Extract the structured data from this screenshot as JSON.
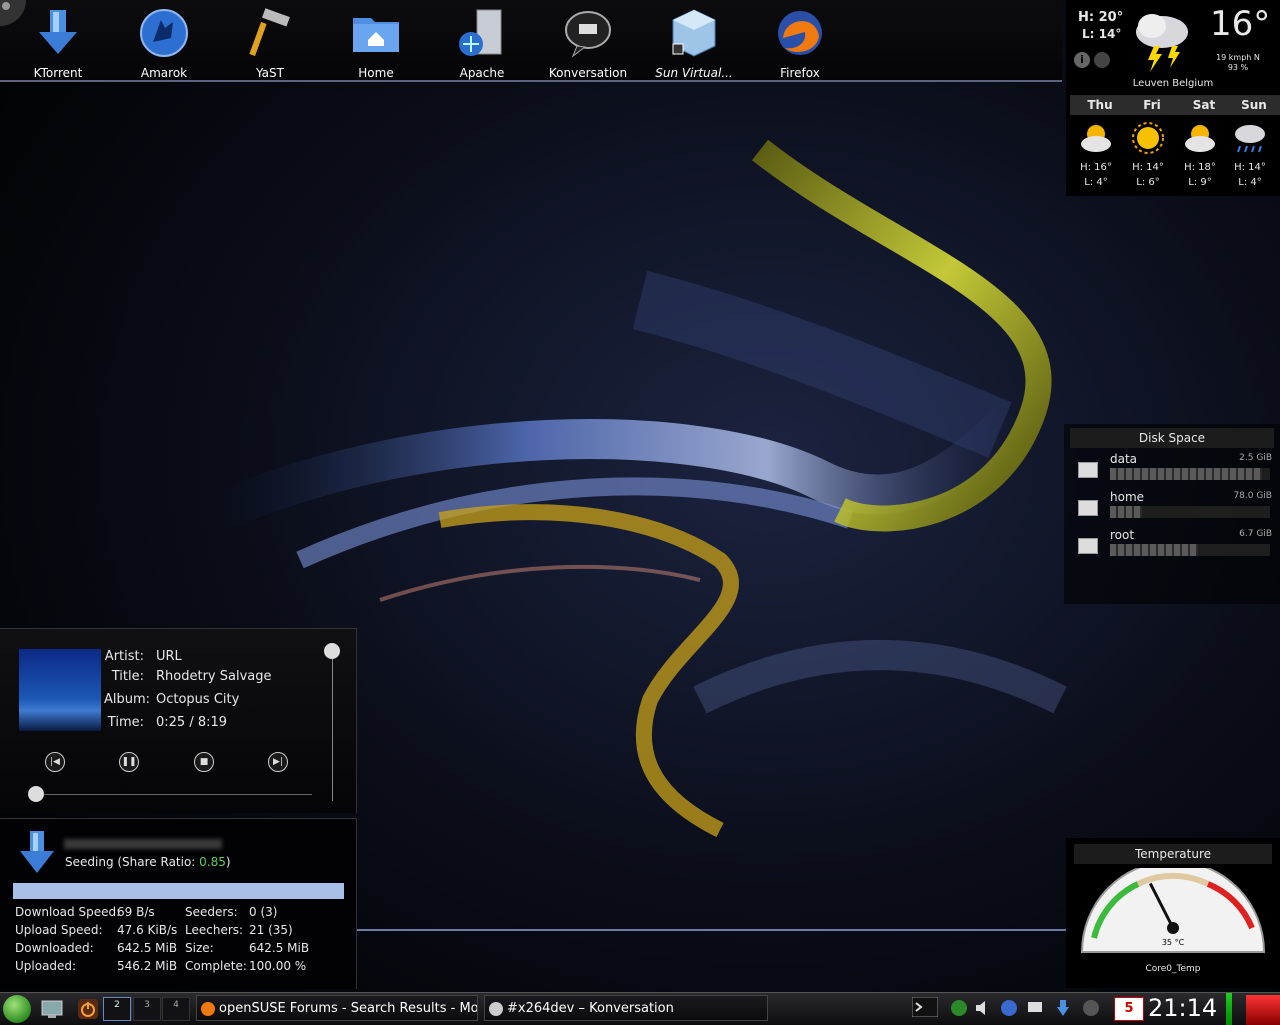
{
  "launcher": {
    "items": [
      {
        "label": "KTorrent",
        "icon": "ktorrent-icon"
      },
      {
        "label": "Amarok",
        "icon": "amarok-icon"
      },
      {
        "label": "YaST",
        "icon": "yast-hammer-icon"
      },
      {
        "label": "Home",
        "icon": "home-folder-icon"
      },
      {
        "label": "Apache",
        "icon": "apache-server-icon"
      },
      {
        "label": "Konversation",
        "icon": "konversation-icon"
      },
      {
        "label": "Sun Virtual...",
        "icon": "virtualbox-icon"
      },
      {
        "label": "Firefox",
        "icon": "firefox-icon"
      }
    ]
  },
  "weather": {
    "high": "H: 20°",
    "low": "L: 14°",
    "current_temp": "16°",
    "wind": "19 kmph N",
    "humidity": "93 %",
    "location": "Leuven Belgium",
    "condition_icon": "thunderstorm-icon",
    "forecast": [
      {
        "day": "Thu",
        "high": "H: 16°",
        "low": "L: 4°",
        "icon": "partly-cloudy-icon"
      },
      {
        "day": "Fri",
        "high": "H: 14°",
        "low": "L: 6°",
        "icon": "sunny-icon"
      },
      {
        "day": "Sat",
        "high": "H: 18°",
        "low": "L: 9°",
        "icon": "partly-cloudy-icon"
      },
      {
        "day": "Sun",
        "high": "H: 14°",
        "low": "L: 4°",
        "icon": "rain-icon"
      }
    ]
  },
  "disk": {
    "title": "Disk Space",
    "items": [
      {
        "name": "data",
        "size": "2.5 GiB",
        "used_fraction": 0.95
      },
      {
        "name": "home",
        "size": "78.0 GiB",
        "used_fraction": 0.2
      },
      {
        "name": "root",
        "size": "6.7 GiB",
        "used_fraction": 0.55
      }
    ]
  },
  "player": {
    "artist_label": "Artist:",
    "artist": "URL",
    "title_label": "Title:",
    "title": "Rhodetry Salvage",
    "album_label": "Album:",
    "album": "Octopus City",
    "time_label": "Time:",
    "time": "0:25 / 8:19"
  },
  "torrent": {
    "status_prefix": "Seeding (Share Ratio: ",
    "ratio": "0.85",
    "status_suffix": ")",
    "progress_percent": 100,
    "download_speed_label": "Download Speed:",
    "download_speed": "69 B/s",
    "upload_speed_label": "Upload Speed:",
    "upload_speed": "47.6 KiB/s",
    "downloaded_label": "Downloaded:",
    "downloaded": "642.5 MiB",
    "uploaded_label": "Uploaded:",
    "uploaded": "546.2 MiB",
    "seeders_label": "Seeders:",
    "seeders": "0 (3)",
    "leechers_label": "Leechers:",
    "leechers": "21 (35)",
    "size_label": "Size:",
    "size": "642.5 MiB",
    "complete_label": "Complete:",
    "complete": "100.00 %"
  },
  "temperature": {
    "title": "Temperature",
    "value": "35 °C",
    "sensor": "Core0_Temp",
    "level_fraction": 0.35
  },
  "taskbar": {
    "pager": [
      "1",
      "2",
      "3",
      "4"
    ],
    "tasks": [
      {
        "label": "openSUSE Forums - Search Results - Mozilla Firefox",
        "icon": "firefox-icon"
      },
      {
        "label": "#x264dev – Konversation",
        "icon": "konversation-icon"
      }
    ],
    "clock": "21:14",
    "mail_count": "5"
  }
}
